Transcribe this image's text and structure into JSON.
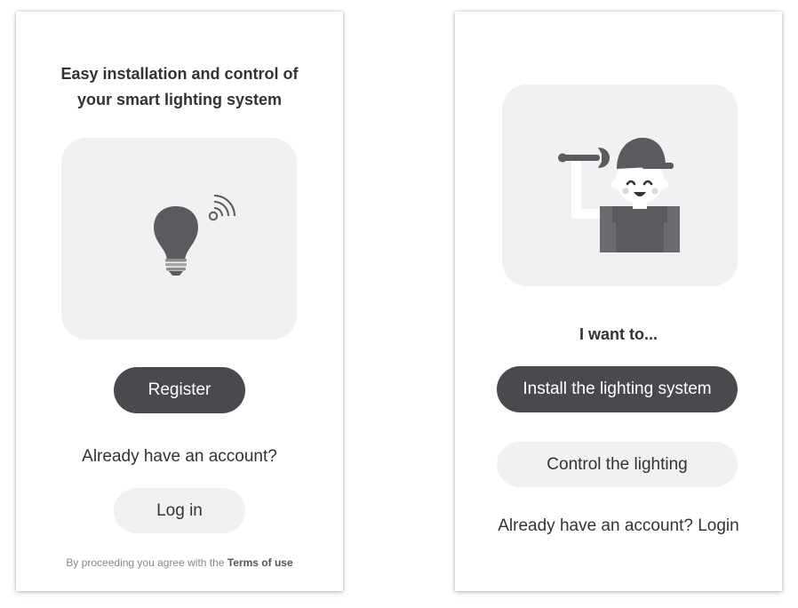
{
  "welcome": {
    "title_line1": "Easy installation and control of",
    "title_line2": "your smart lighting system",
    "illustration_icon": "smart-bulb-wifi-icon",
    "register_label": "Register",
    "account_question": "Already have an account?",
    "login_label": "Log in",
    "terms_prefix": "By proceeding you agree with the",
    "terms_link": "Terms of use"
  },
  "role_select": {
    "illustration_icon": "installer-worker-icon",
    "prompt": "I want to...",
    "install_label": "Install the lighting system",
    "control_label": "Control the lighting",
    "account_login": "Already have an account? Login"
  },
  "colors": {
    "primary_button": "#4a4a4e",
    "secondary_button": "#f1f1f1",
    "card_background": "#f1f1f1"
  }
}
